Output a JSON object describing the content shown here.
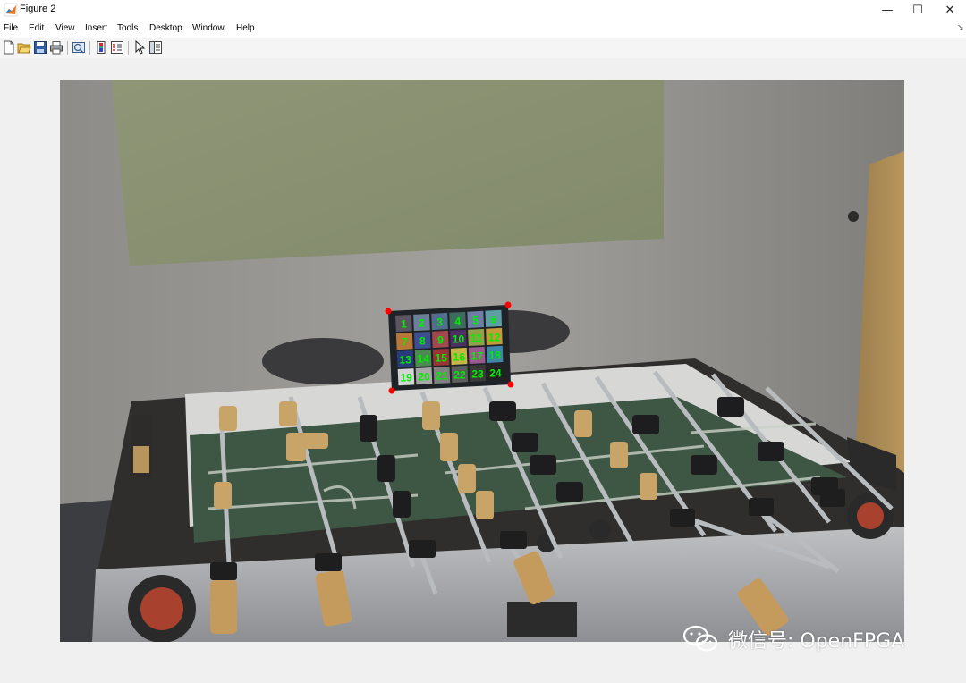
{
  "window": {
    "title": "Figure 2",
    "controls": {
      "minimize": "—",
      "maximize": "☐",
      "close": "✕"
    }
  },
  "menu": {
    "items": [
      "File",
      "Edit",
      "View",
      "Insert",
      "Tools",
      "Desktop",
      "Window",
      "Help"
    ],
    "dock_arrow": "↘"
  },
  "toolbar": {
    "buttons": [
      {
        "name": "new-figure-icon"
      },
      {
        "name": "open-file-icon"
      },
      {
        "name": "save-icon"
      },
      {
        "name": "print-icon"
      },
      {
        "name": "link-plot-icon"
      },
      {
        "name": "insert-colorbar-icon"
      },
      {
        "name": "insert-legend-icon"
      },
      {
        "name": "edit-plot-arrow-icon"
      },
      {
        "name": "property-inspector-icon"
      }
    ]
  },
  "chart_labels": {
    "numbers": [
      "1",
      "2",
      "3",
      "4",
      "5",
      "6",
      "7",
      "8",
      "9",
      "10",
      "11",
      "12",
      "13",
      "14",
      "15",
      "16",
      "17",
      "18",
      "19",
      "20",
      "21",
      "22",
      "23",
      "24"
    ],
    "label_color": "#00ee00",
    "corner_marker_color": "#ff0000"
  },
  "watermark": {
    "text": "微信号: OpenFPGA"
  }
}
